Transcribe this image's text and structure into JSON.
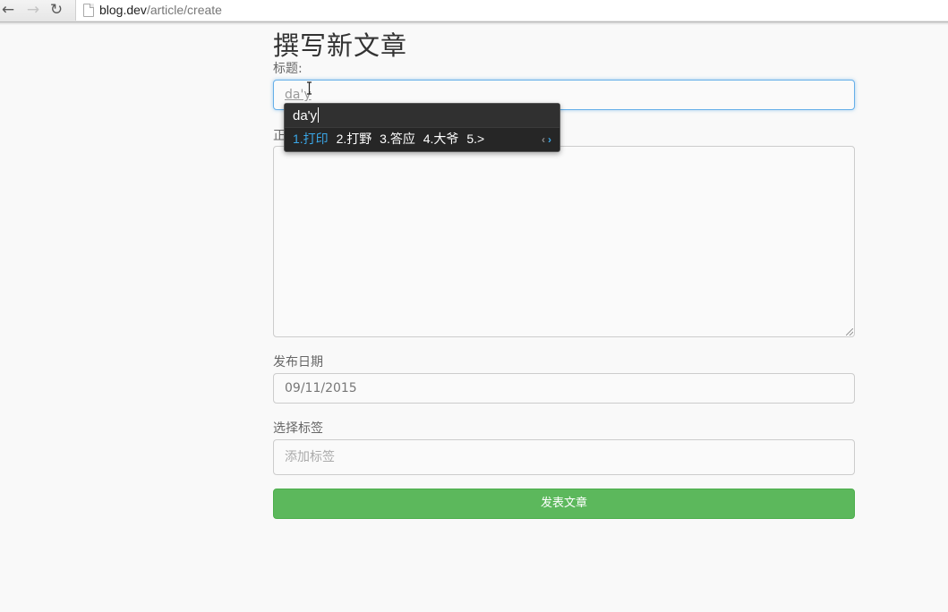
{
  "browser": {
    "url_host": "blog.dev",
    "url_path": "/article/create",
    "icons": {
      "back": "back-arrow-icon",
      "forward": "forward-arrow-icon",
      "reload": "reload-icon"
    }
  },
  "form": {
    "heading": "撰写新文章",
    "title_label": "标题:",
    "title_value": "da'y",
    "body_label": "正",
    "body_value": "",
    "date_label": "发布日期",
    "date_value": "09/11/2015",
    "tags_label": "选择标签",
    "tags_placeholder": "添加标签",
    "submit_label": "发表文章"
  },
  "ime": {
    "composition": "da'y",
    "candidates": [
      "1.打印",
      "2.打野",
      "3.答应",
      "4.大爷",
      "5.>"
    ],
    "selected_index": 0,
    "colors": {
      "background": "#262626",
      "selected": "#3aa7e8"
    }
  },
  "colors": {
    "submit": "#5cb85c",
    "focus_border": "#66afe9"
  }
}
